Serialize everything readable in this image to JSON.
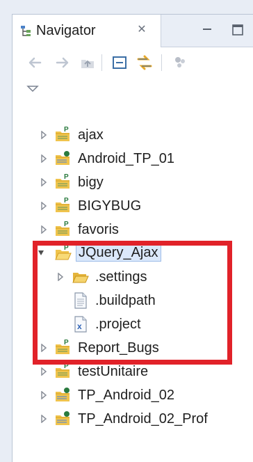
{
  "navigator": {
    "title": "Navigator",
    "close_icon": "close-icon",
    "minimize_icon": "minimize-icon",
    "maximize_icon": "maximize-icon",
    "toolbar": {
      "back_icon": "back-arrow-icon",
      "forward_icon": "forward-arrow-icon",
      "up_icon": "up-folder-icon",
      "collapse_icon": "collapse-all-icon",
      "link_icon": "link-with-editor-icon",
      "filter_icon": "filter-icon",
      "view_menu_icon": "view-menu-icon"
    },
    "tree": [
      {
        "label": "ajax",
        "type": "project",
        "expanded": false
      },
      {
        "label": "Android_TP_01",
        "type": "android-project",
        "expanded": false
      },
      {
        "label": "bigy",
        "type": "project",
        "expanded": false
      },
      {
        "label": "BIGYBUG",
        "type": "project",
        "expanded": false
      },
      {
        "label": "favoris",
        "type": "project",
        "expanded": false
      },
      {
        "label": "JQuery_Ajax",
        "type": "open-project",
        "expanded": true,
        "selected": true
      },
      {
        "label": ".settings",
        "type": "folder",
        "expanded": false,
        "child": true
      },
      {
        "label": ".buildpath",
        "type": "file",
        "child": true
      },
      {
        "label": ".project",
        "type": "xml-file",
        "child": true
      },
      {
        "label": "Report_Bugs",
        "type": "project",
        "expanded": false
      },
      {
        "label": "testUnitaire",
        "type": "project",
        "expanded": false
      },
      {
        "label": "TP_Android_02",
        "type": "android-project",
        "expanded": false
      },
      {
        "label": "TP_Android_02_Prof",
        "type": "android-project",
        "expanded": false
      }
    ]
  },
  "colors": {
    "highlight": "#e12229",
    "selection": "#dbe8fb",
    "folder": "#f0c44d",
    "project_badge": "#2a7a3e"
  }
}
